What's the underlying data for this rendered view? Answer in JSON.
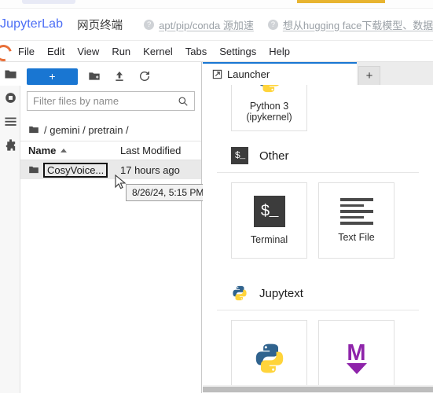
{
  "browser": {
    "tab_ghost": "",
    "bookmark_highlight_color": "#e8b430"
  },
  "site_header": {
    "brand": "JupyterLab",
    "nav_cn": "网页终端",
    "links": [
      {
        "icon": "question-mark-icon",
        "label": "apt/pip/conda 源加速"
      },
      {
        "icon": "question-mark-icon",
        "label": "想从hugging face下载模型、数据集"
      }
    ]
  },
  "menubar": {
    "logo": "jupyter-logo-icon",
    "items": [
      "File",
      "Edit",
      "View",
      "Run",
      "Kernel",
      "Tabs",
      "Settings",
      "Help"
    ]
  },
  "activitybar": {
    "items": [
      {
        "name": "file-browser-icon",
        "selected": true
      },
      {
        "name": "running-terminals-icon",
        "selected": false
      },
      {
        "name": "commands-list-icon",
        "selected": false
      },
      {
        "name": "extension-manager-icon",
        "selected": false
      }
    ]
  },
  "filebrowser": {
    "toolbar": {
      "new_launcher_label": "+",
      "new_folder_icon": "new-folder-icon",
      "upload_icon": "upload-icon",
      "refresh_icon": "refresh-icon"
    },
    "filter": {
      "placeholder": "Filter files by name",
      "value": "",
      "icon": "search-icon"
    },
    "breadcrumb": "/ gemini / pretrain /",
    "columns": {
      "name": "Name",
      "last_modified": "Last Modified"
    },
    "sort": "ascending",
    "rows": [
      {
        "icon": "folder-icon",
        "name": "CosyVoice...",
        "last_modified": "17 hours ago",
        "selected": true,
        "editing": true
      }
    ],
    "tooltip": "8/26/24, 5:15 PM"
  },
  "dock": {
    "tabs": [
      {
        "icon": "launcher-icon",
        "label": "Launcher",
        "active": true
      }
    ],
    "add_tab_label": "+"
  },
  "launcher": {
    "top_partial_card": {
      "icon": "python-icon",
      "label": "Python 3\n(ipykernel)",
      "line1": "Python 3",
      "line2": "(ipykernel)"
    },
    "sections": [
      {
        "icon": "terminal-icon",
        "title": "Other",
        "cards": [
          {
            "icon": "terminal-icon",
            "label": "Terminal"
          },
          {
            "icon": "text-file-icon",
            "label": "Text File"
          }
        ]
      },
      {
        "icon": "python-icon",
        "title": "Jupytext",
        "cards": [
          {
            "icon": "python-icon",
            "label": ""
          },
          {
            "icon": "markdown-icon",
            "label": "M"
          }
        ]
      }
    ]
  },
  "colors": {
    "accent_blue": "#1976d2",
    "brand_blue": "#4c6ef5",
    "python_blue": "#30638e",
    "python_yellow": "#ffd43b",
    "markdown_purple": "#8e24aa",
    "terminal_dark": "#3c3c3c"
  }
}
